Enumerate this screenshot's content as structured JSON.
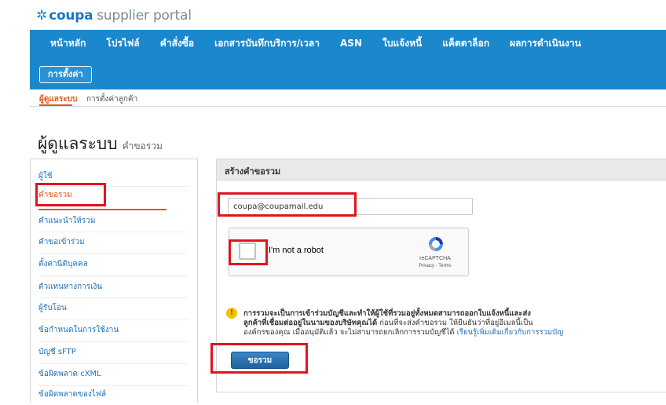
{
  "logo": {
    "brand": "coupa",
    "rest": "supplier portal"
  },
  "nav": {
    "items": [
      "หน้าหลัก",
      "โปรไฟล์",
      "คำสั่งซื้อ",
      "เอกสารบันทึกบริการ/เวลา",
      "ASN",
      "ใบแจ้งหนี้",
      "แค็ตตาล็อก",
      "ผลการดำเนินงาน"
    ],
    "settings": "การตั้งค่า"
  },
  "subnav": {
    "admin": "ผู้ดูแลระบบ",
    "customer_settings": "การตั้งค่าลูกค้า"
  },
  "page": {
    "title": "ผู้ดูแลระบบ",
    "subtitle": "คำขอรวม"
  },
  "sidebar": {
    "items": [
      "ผู้ใช้",
      "คำขอรวม",
      "คำแนะนำให้รวม",
      "คำขอเข้าร่วม",
      "ตั้งค่านิติบุคคล",
      "ตัวแทนทางการเงิน",
      "ผู้รับโอน",
      "ข้อกำหนดในการใช้งาน",
      "บัญชี sFTP",
      "ข้อผิดพลาด cXML",
      "ข้อผิดพลาดของไฟล์"
    ],
    "active_index": 1
  },
  "panel": {
    "header": "สร้างคำขอรวม",
    "email_value": "coupa@coupamail.edu",
    "recaptcha": {
      "label": "I'm not a robot",
      "brand": "reCAPTCHA",
      "links": "Privacy - Terms"
    },
    "notice": {
      "line1_bold": "การรวมจะเป็นการเข้าร่วมบัญชีและทำให้ผู้ใช้ที่รวมอยู่ทั้งหมดสามารถออกใบแจ้งหนี้และส่ง",
      "line2_bold": "ลูกค้าที่เชื่อมต่ออยู่ในนามของบริษัทคุณได้",
      "line2_rest": "ก่อนที่จะส่งคำขอรวม ให้ยืนยันว่าที่อยู่อีเมลนี้เป็น",
      "line3_text": "องค์กรของคุณ เมื่ออนุมัติแล้ว จะไม่สามารถยกเลิกการรวมบัญชีได้",
      "line3_link": "เรียนรู้เพิ่มเติมเกี่ยวกับการรวมบัญ"
    },
    "submit": "ขอรวม"
  },
  "colors": {
    "nav_bg": "#1b87cc",
    "accent": "#e0571e",
    "highlight": "#e3141d",
    "link": "#1f6fb8",
    "button": "#1f6fae"
  }
}
